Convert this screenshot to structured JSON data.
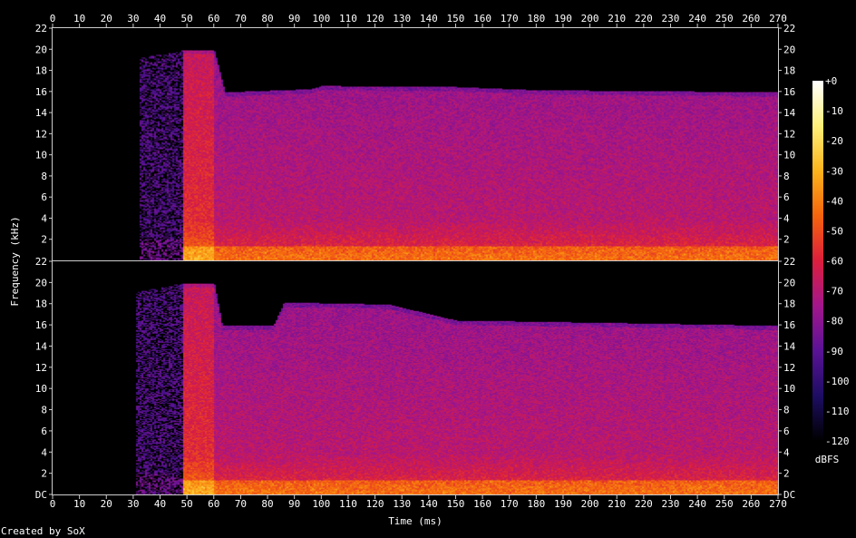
{
  "chart_data": {
    "type": "heatmap",
    "title": "",
    "xlabel": "Time (ms)",
    "ylabel": "Frequency (kHz)",
    "xlim": [
      0,
      270
    ],
    "ylim_khz": [
      0,
      22
    ],
    "x_ticks": [
      "0",
      "10",
      "20",
      "30",
      "40",
      "50",
      "60",
      "70",
      "80",
      "90",
      "100",
      "110",
      "120",
      "130",
      "140",
      "150",
      "160",
      "170",
      "180",
      "190",
      "200",
      "210",
      "220",
      "230",
      "240",
      "250",
      "260",
      "270"
    ],
    "y_ticks_top": [
      "2",
      "4",
      "6",
      "8",
      "10",
      "12",
      "14",
      "16",
      "18",
      "20",
      "22"
    ],
    "y_ticks_bottom": [
      "DC",
      "2",
      "4",
      "6",
      "8",
      "10",
      "12",
      "14",
      "16",
      "18",
      "20",
      "22"
    ],
    "channels": [
      {
        "onset_ms": 48,
        "transient_ms": [
          48,
          60
        ],
        "pre_echo_start_ms": 32,
        "bandwidth_khz": [
          [
            48,
            20
          ],
          [
            60,
            20
          ],
          [
            64,
            16
          ],
          [
            96,
            16.3
          ],
          [
            100,
            16.6
          ],
          [
            150,
            16.5
          ],
          [
            180,
            16.2
          ],
          [
            270,
            16
          ]
        ]
      },
      {
        "onset_ms": 48,
        "transient_ms": [
          48,
          60
        ],
        "pre_echo_start_ms": 31,
        "bandwidth_khz": [
          [
            48,
            20
          ],
          [
            60,
            20
          ],
          [
            63,
            16
          ],
          [
            82,
            16
          ],
          [
            86,
            18.2
          ],
          [
            125,
            18
          ],
          [
            150,
            16.5
          ],
          [
            200,
            16.3
          ],
          [
            270,
            16
          ]
        ]
      }
    ],
    "colorbar": {
      "unit": "dBFS",
      "ticks": [
        "+0",
        "-10",
        "-20",
        "-30",
        "-40",
        "-50",
        "-60",
        "-70",
        "-80",
        "-90",
        "-100",
        "-110",
        "-120"
      ],
      "colors": [
        "#000000",
        "#1d0d63",
        "#5a1296",
        "#a3168c",
        "#dc1e3d",
        "#f5640c",
        "#fcb31c",
        "#fff07a",
        "#ffffff"
      ]
    }
  },
  "credit": "Created by SoX"
}
